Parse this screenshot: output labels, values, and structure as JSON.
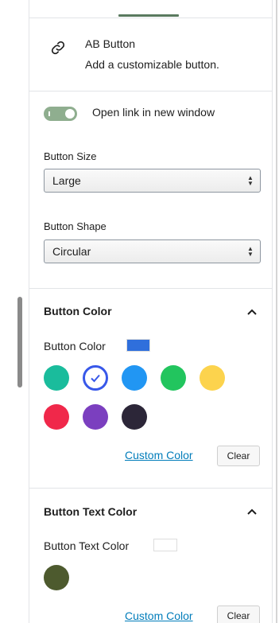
{
  "block": {
    "title": "AB Button",
    "description": "Add a customizable button.",
    "icon": "link-icon"
  },
  "link_toggle": {
    "label": "Open link in new window",
    "checked": true,
    "color": "#8fae8f"
  },
  "button_size": {
    "label": "Button Size",
    "value": "Large"
  },
  "button_shape": {
    "label": "Button Shape",
    "value": "Circular"
  },
  "button_color": {
    "section_title": "Button Color",
    "label": "Button Color",
    "current_color": "#2f6fdc",
    "palette": [
      "#1abc9c",
      "#3858e9",
      "#2196f3",
      "#22c55e",
      "#fcd34d",
      "#f0284a",
      "#7b3fbf",
      "#2c2638"
    ],
    "selected_index": 1,
    "custom_color_label": "Custom Color",
    "clear_label": "Clear"
  },
  "text_color": {
    "section_title": "Button Text Color",
    "label": "Button Text Color",
    "current_color": "#ffffff",
    "palette": [
      "#4d5a2e"
    ],
    "custom_color_label": "Custom Color",
    "clear_label": "Clear"
  }
}
